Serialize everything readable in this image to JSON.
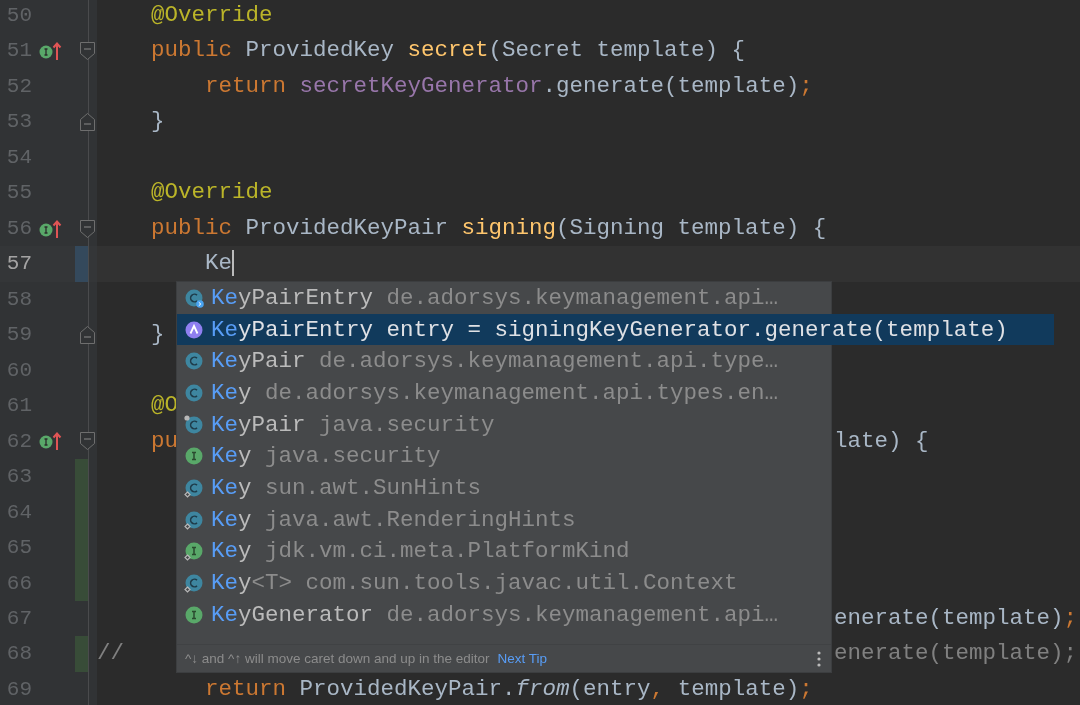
{
  "lines": [
    {
      "number": "50",
      "code": [
        {
          "kind": "annotation",
          "text": "    @Override"
        }
      ]
    },
    {
      "number": "51",
      "implemented": true,
      "fold_start": true,
      "code": [
        {
          "kind": "keyword",
          "text": "    public"
        },
        {
          "kind": "plain",
          "text": " ProvidedKey "
        },
        {
          "kind": "decl",
          "text": "secret"
        },
        {
          "kind": "plain",
          "text": "(Secret template) {"
        }
      ]
    },
    {
      "number": "52",
      "code": [
        {
          "kind": "keyword",
          "text": "        return "
        },
        {
          "kind": "field",
          "text": "secretKeyGenerator"
        },
        {
          "kind": "plain",
          "text": ".generate(template)"
        },
        {
          "kind": "punct",
          "text": ";"
        }
      ]
    },
    {
      "number": "53",
      "fold_end": true,
      "code": [
        {
          "kind": "plain",
          "text": "    }"
        }
      ]
    },
    {
      "number": "54"
    },
    {
      "number": "55",
      "code": [
        {
          "kind": "annotation",
          "text": "    @Override"
        }
      ]
    },
    {
      "number": "56",
      "implemented": true,
      "fold_start": true,
      "code": [
        {
          "kind": "keyword",
          "text": "    public"
        },
        {
          "kind": "plain",
          "text": " ProvidedKeyPair "
        },
        {
          "kind": "decl",
          "text": "signing"
        },
        {
          "kind": "plain",
          "text": "(Signing template) {"
        }
      ]
    },
    {
      "number": "57",
      "current": true,
      "caret": true,
      "code": [
        {
          "kind": "plain",
          "text": "        Ke"
        }
      ]
    },
    {
      "number": "58"
    },
    {
      "number": "59",
      "fold_end": true,
      "code": [
        {
          "kind": "plain",
          "text": "    }"
        }
      ]
    },
    {
      "number": "60"
    },
    {
      "number": "61",
      "code": [
        {
          "kind": "annotation",
          "text": "    @O"
        }
      ]
    },
    {
      "number": "62",
      "implemented": true,
      "fold_start": true,
      "code": [
        {
          "kind": "keyword",
          "text": "    pu"
        }
      ],
      "code_right": [
        {
          "kind": "plain",
          "text": "late) {"
        }
      ]
    },
    {
      "number": "63",
      "changed": true
    },
    {
      "number": "64",
      "changed": true
    },
    {
      "number": "65",
      "changed": true
    },
    {
      "number": "66",
      "changed": true
    },
    {
      "number": "67",
      "code_right": [
        {
          "kind": "plain",
          "text": "enerate(template)"
        },
        {
          "kind": "punct",
          "text": ";"
        }
      ]
    },
    {
      "number": "68",
      "changed": true,
      "code": [
        {
          "kind": "comment",
          "text": "//"
        }
      ],
      "code_right": [
        {
          "kind": "comment",
          "text": "enerate(template);"
        }
      ]
    },
    {
      "number": "69",
      "code": [
        {
          "kind": "keyword",
          "text": "        return"
        },
        {
          "kind": "plain",
          "text": " ProvidedKeyPair."
        },
        {
          "kind": "static",
          "text": "from"
        },
        {
          "kind": "plain",
          "text": "(entry"
        },
        {
          "kind": "punct",
          "text": ","
        },
        {
          "kind": "plain",
          "text": " template)"
        },
        {
          "kind": "punct",
          "text": ";"
        }
      ]
    }
  ],
  "popup": {
    "items": [
      {
        "kind": "class",
        "linked": true,
        "match": "Ke",
        "name": "yPairEntry",
        "detail": "de.adorsys.keymanagement.api…",
        "selected": false
      },
      {
        "kind": "template",
        "match": "Ke",
        "name": "yPairEntry entry = signingKeyGenerator.generate(template)",
        "selected": true
      },
      {
        "kind": "class",
        "match": "Ke",
        "name": "yPair",
        "detail": "de.adorsys.keymanagement.api.type…",
        "selected": false
      },
      {
        "kind": "class",
        "match": "Ke",
        "name": "y",
        "detail": "de.adorsys.keymanagement.api.types.en…",
        "selected": false
      },
      {
        "kind": "class",
        "pinned": true,
        "match": "Ke",
        "name": "yPair",
        "detail": "java.security",
        "selected": false
      },
      {
        "kind": "interface",
        "match": "Ke",
        "name": "y",
        "detail": "java.security",
        "selected": false
      },
      {
        "kind": "class",
        "static": true,
        "match": "Ke",
        "name": "y",
        "detail": "sun.awt.SunHints",
        "selected": false
      },
      {
        "kind": "class",
        "static": true,
        "match": "Ke",
        "name": "y",
        "detail": "java.awt.RenderingHints",
        "selected": false
      },
      {
        "kind": "interface",
        "static": true,
        "match": "Ke",
        "name": "y",
        "detail": "jdk.vm.ci.meta.PlatformKind",
        "selected": false
      },
      {
        "kind": "class",
        "static": true,
        "match": "Ke",
        "name": "y",
        "generic": "<T>",
        "detail": "com.sun.tools.javac.util.Context",
        "selected": false
      },
      {
        "kind": "interface",
        "match": "Ke",
        "name": "yGenerator",
        "detail": "de.adorsys.keymanagement.api…",
        "selected": false
      }
    ],
    "tip": "^↓ and ^↑ will move caret down and up in the editor",
    "tip_link": "Next Tip"
  }
}
